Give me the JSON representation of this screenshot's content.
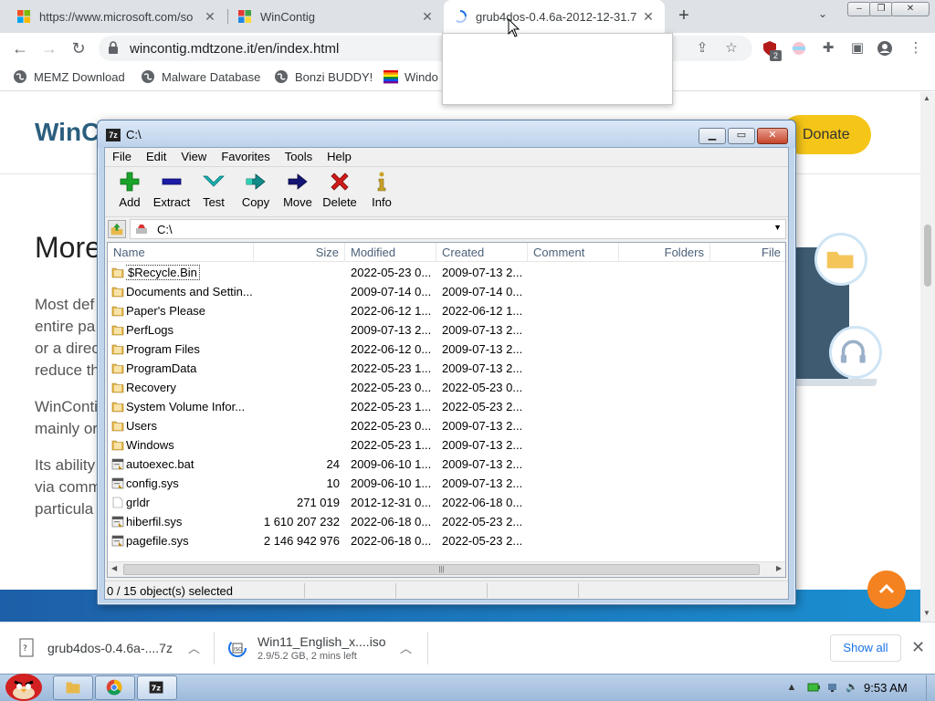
{
  "browser": {
    "tabs": [
      {
        "title": "https://www.microsoft.com/so",
        "close": "✕"
      },
      {
        "title": "WinContig",
        "close": "✕"
      },
      {
        "title": "grub4dos-0.4.6a-2012-12-31.7",
        "close": "✕"
      }
    ],
    "new_tab": "+",
    "url": "wincontig.mdtzone.it/en/index.html",
    "extension_badge": "2",
    "bookmarks": [
      {
        "label": "MEMZ Download"
      },
      {
        "label": "Malware Database"
      },
      {
        "label": "Bonzi BUDDY!"
      },
      {
        "label": "Windo"
      }
    ]
  },
  "website": {
    "logo_text": "WinCo",
    "donate_label": "Donate",
    "heading": "More",
    "paragraphs": [
      [
        "Most def",
        "entire pa",
        "or a direc",
        "reduce th"
      ],
      [
        "WinConti",
        "mainly or"
      ],
      [
        "Its ability",
        "via comm",
        "particula"
      ]
    ]
  },
  "sevenzip": {
    "title": "C:\\",
    "app_icon_text": "7z",
    "menu": [
      "File",
      "Edit",
      "View",
      "Favorites",
      "Tools",
      "Help"
    ],
    "toolbar": [
      {
        "label": "Add",
        "icon": "plus-icon",
        "color": "#1aa32a"
      },
      {
        "label": "Extract",
        "icon": "minus-icon",
        "color": "#1c1ca8"
      },
      {
        "label": "Test",
        "icon": "check-chevron-icon",
        "color": "#18b5b5"
      },
      {
        "label": "Copy",
        "icon": "double-arrow-icon",
        "color": "#118a88"
      },
      {
        "label": "Move",
        "icon": "arrow-right-icon",
        "color": "#141475"
      },
      {
        "label": "Delete",
        "icon": "x-icon",
        "color": "#d11a1a"
      },
      {
        "label": "Info",
        "icon": "info-icon",
        "color": "#c9a227"
      }
    ],
    "path": "C:\\",
    "columns": [
      "Name",
      "Size",
      "Modified",
      "Created",
      "Comment",
      "Folders",
      "File"
    ],
    "rows": [
      {
        "name": "$Recycle.Bin",
        "size": "",
        "modified": "2022-05-23 0...",
        "created": "2009-07-13 2...",
        "type": "folder"
      },
      {
        "name": "Documents and Settin...",
        "size": "",
        "modified": "2009-07-14 0...",
        "created": "2009-07-14 0...",
        "type": "folder"
      },
      {
        "name": "Paper's Please",
        "size": "",
        "modified": "2022-06-12 1...",
        "created": "2022-06-12 1...",
        "type": "folder"
      },
      {
        "name": "PerfLogs",
        "size": "",
        "modified": "2009-07-13 2...",
        "created": "2009-07-13 2...",
        "type": "folder"
      },
      {
        "name": "Program Files",
        "size": "",
        "modified": "2022-06-12 0...",
        "created": "2009-07-13 2...",
        "type": "folder"
      },
      {
        "name": "ProgramData",
        "size": "",
        "modified": "2022-05-23 1...",
        "created": "2009-07-13 2...",
        "type": "folder"
      },
      {
        "name": "Recovery",
        "size": "",
        "modified": "2022-05-23 0...",
        "created": "2022-05-23 0...",
        "type": "folder"
      },
      {
        "name": "System Volume Infor...",
        "size": "",
        "modified": "2022-05-23 1...",
        "created": "2022-05-23 2...",
        "type": "folder"
      },
      {
        "name": "Users",
        "size": "",
        "modified": "2022-05-23 0...",
        "created": "2009-07-13 2...",
        "type": "folder"
      },
      {
        "name": "Windows",
        "size": "",
        "modified": "2022-05-23 1...",
        "created": "2009-07-13 2...",
        "type": "folder"
      },
      {
        "name": "autoexec.bat",
        "size": "24",
        "modified": "2009-06-10 1...",
        "created": "2009-07-13 2...",
        "type": "sysfile"
      },
      {
        "name": "config.sys",
        "size": "10",
        "modified": "2009-06-10 1...",
        "created": "2009-07-13 2...",
        "type": "sysfile"
      },
      {
        "name": "grldr",
        "size": "271 019",
        "modified": "2012-12-31 0...",
        "created": "2022-06-18 0...",
        "type": "file"
      },
      {
        "name": "hiberfil.sys",
        "size": "1 610 207 232",
        "modified": "2022-06-18 0...",
        "created": "2022-05-23 2...",
        "type": "sysfile"
      },
      {
        "name": "pagefile.sys",
        "size": "2 146 942 976",
        "modified": "2022-06-18 0...",
        "created": "2022-05-23 2...",
        "type": "sysfile"
      }
    ],
    "status": "0 / 15 object(s) selected"
  },
  "downloads": [
    {
      "name": "grub4dos-0.4.6a-....7z",
      "sub": ""
    },
    {
      "name": "Win11_English_x....iso",
      "sub": "2.9/5.2 GB, 2 mins left"
    }
  ],
  "show_all": "Show all",
  "taskbar": {
    "clock": "9:53 AM"
  },
  "colors": {
    "accent_blue": "#1a73e8",
    "donate_yellow": "#f5c518",
    "scroll_orange": "#f58220",
    "folder_yellow": "#e8b84a"
  }
}
